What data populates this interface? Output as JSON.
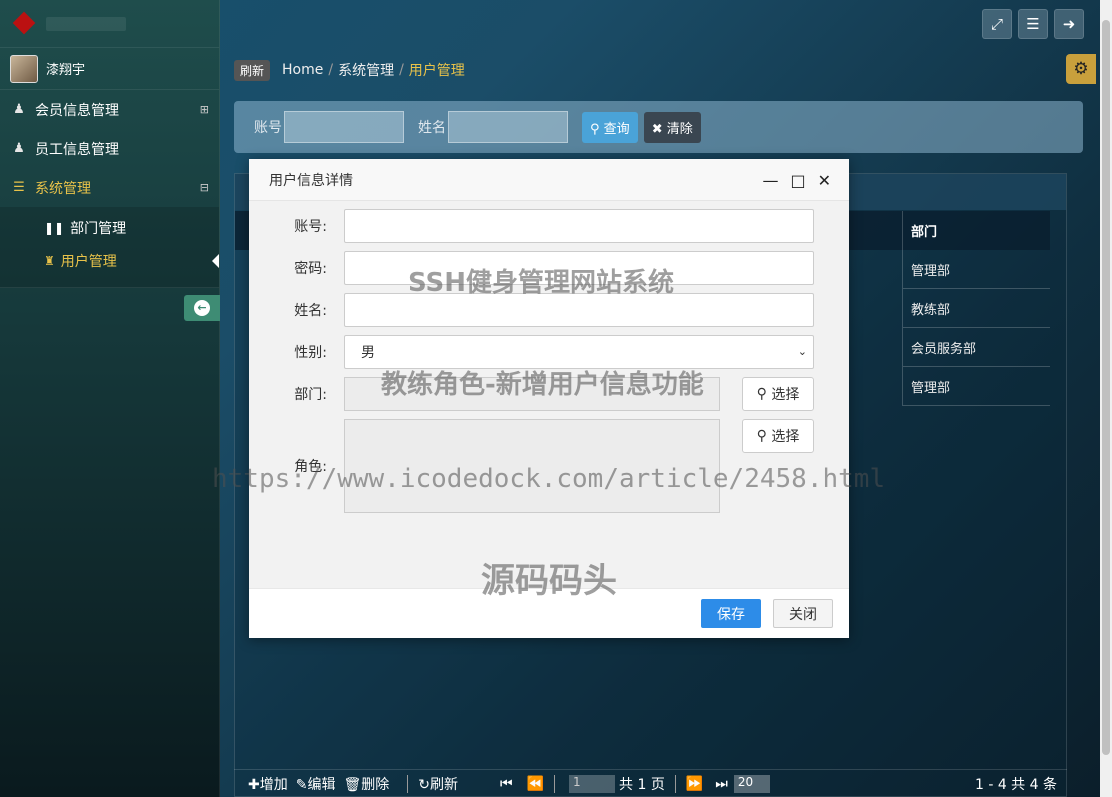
{
  "sidebar": {
    "user_name": "漆翔宇",
    "nav": [
      {
        "label": "会员信息管理",
        "icon": "user-icon",
        "expander": "⊞"
      },
      {
        "label": "员工信息管理",
        "icon": "user-icon"
      },
      {
        "label": "系统管理",
        "icon": "list-icon",
        "expander": "⊟"
      }
    ],
    "sub_items": [
      {
        "label": "部门管理",
        "icon": "pause-icon"
      },
      {
        "label": "用户管理",
        "icon": "rook-icon"
      }
    ]
  },
  "breadcrumb": {
    "refresh": "刷新",
    "home": "Home",
    "level1": "系统管理",
    "current": "用户管理",
    "separator": "/"
  },
  "search": {
    "account_label": "账号",
    "name_label": "姓名",
    "query": "查询",
    "clear": "清除"
  },
  "table": {
    "dept_header": "部门",
    "dept_values": [
      "管理部",
      "教练部",
      "会员服务部",
      "管理部"
    ]
  },
  "pager": {
    "add": "增加",
    "edit": "编辑",
    "delete": "删除",
    "refresh": "刷新",
    "page_value": "1",
    "total_pages": "共 1 页",
    "page_size": "20",
    "info": "1 - 4    共 4 条"
  },
  "dialog": {
    "title": "用户信息详情",
    "account_label": "账号:",
    "password_label": "密码:",
    "name_label": "姓名:",
    "gender_label": "性别:",
    "gender_value": "男",
    "dept_label": "部门:",
    "role_label": "角色:",
    "pick": "选择",
    "save": "保存",
    "close": "关闭"
  },
  "watermarks": {
    "line1": "SSH健身管理网站系统",
    "line2": "教练角色-新增用户信息功能",
    "line3": "https://www.icodedock.com/article/2458.html",
    "line4": "源码码头"
  },
  "colors": {
    "accent": "#e8c24a",
    "primary_button": "#2d8ce8",
    "query_button": "#4aa3d8"
  }
}
